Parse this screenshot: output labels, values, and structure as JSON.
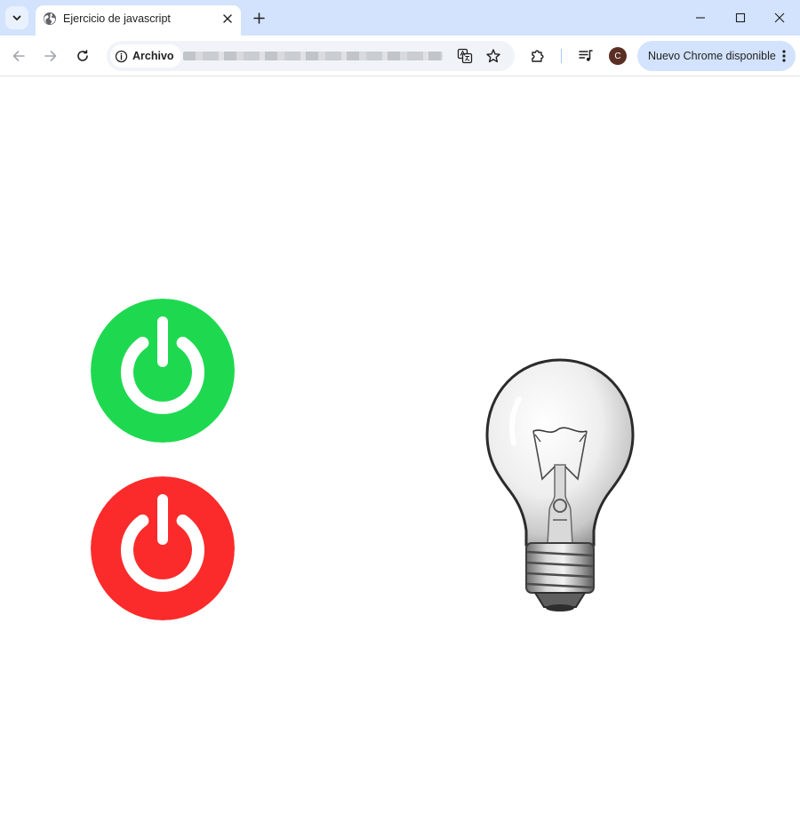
{
  "browser": {
    "tab": {
      "title": "Ejercicio de javascript"
    },
    "address": {
      "security_label": "Archivo"
    },
    "profile_initial": "C",
    "update_button": {
      "label": "Nuevo Chrome disponible"
    }
  },
  "page": {
    "buttons": [
      {
        "name": "power-on",
        "color": "#1ed94f"
      },
      {
        "name": "power-off",
        "color": "#fb2b2b"
      }
    ],
    "bulb_state": "off"
  },
  "colors": {
    "tabstrip": "#d3e3fd",
    "omnibox": "#f0f4f9",
    "on": "#1ed94f",
    "off": "#fb2b2b"
  }
}
